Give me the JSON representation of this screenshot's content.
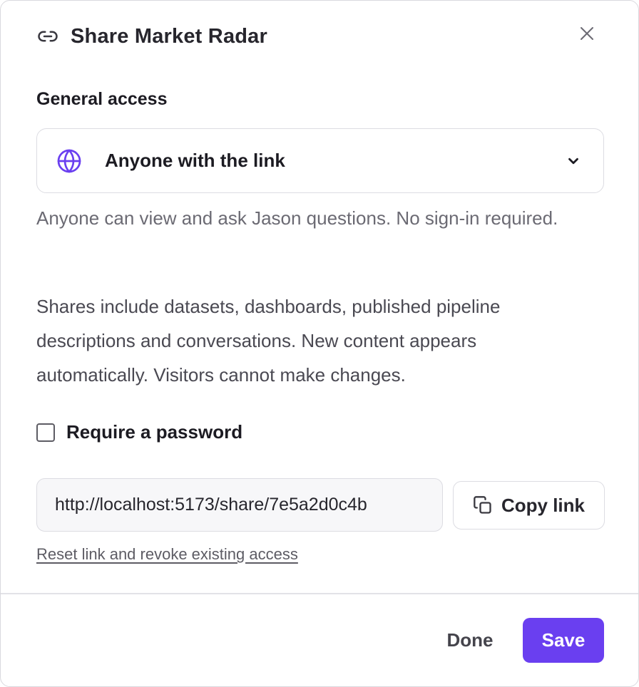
{
  "dialog": {
    "title": "Share Market Radar",
    "close_icon": "close-icon",
    "title_icon": "link-icon"
  },
  "general_access": {
    "label": "General access",
    "selected": "Anyone with the link",
    "icon": "globe-icon",
    "hint": "Anyone can view and ask Jason questions. No sign-in required."
  },
  "info_text": "Shares include datasets, dashboards, published pipeline descriptions and conversations. New content appears automatically. Visitors cannot make changes.",
  "password": {
    "label": "Require a password",
    "checked": false
  },
  "share_link": {
    "value": "http://localhost:5173/share/7e5a2d0c4b",
    "copy_label": "Copy link",
    "copy_icon": "copy-icon"
  },
  "reset_link_label": "Reset link and revoke existing access",
  "footer": {
    "done_label": "Done",
    "save_label": "Save"
  },
  "colors": {
    "accent": "#6a3ff0",
    "globe": "#6a3ff0"
  }
}
